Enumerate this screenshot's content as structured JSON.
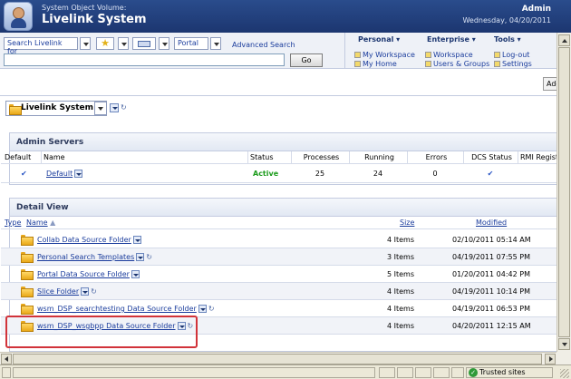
{
  "header": {
    "volume_label": "System Object Volume:",
    "system_title": "Livelink System",
    "user": "Admin",
    "date": "Wednesday, 04/20/2011"
  },
  "search": {
    "scope_label": "Search Livelink for",
    "portal_label": "Portal",
    "advanced_link": "Advanced Search",
    "go_label": "Go",
    "query_value": ""
  },
  "menus": {
    "personal": {
      "label": "Personal ▾",
      "items": [
        "My Workspace",
        "My Home"
      ]
    },
    "enterprise": {
      "label": "Enterprise ▾",
      "items": [
        "Workspace",
        "Users & Groups"
      ]
    },
    "tools": {
      "label": "Tools ▾",
      "items": [
        "Log-out",
        "Settings"
      ]
    }
  },
  "toolbar": {
    "add_label": "Add Item",
    "location_label": "Livelink System"
  },
  "admin_servers": {
    "title": "Admin Servers",
    "columns": [
      "Default",
      "Name",
      "Status",
      "Processes",
      "Running",
      "Errors",
      "DCS Status",
      "RMI Registry"
    ],
    "rows": [
      {
        "name": "Default",
        "status": "Active",
        "processes": "25",
        "running": "24",
        "errors": "0"
      }
    ]
  },
  "detail_view": {
    "title": "Detail View",
    "columns": {
      "type": "Type",
      "name": "Name",
      "size": "Size",
      "modified": "Modified"
    },
    "rows": [
      {
        "name": "Collab Data Source Folder",
        "size": "4 Items",
        "modified": "02/10/2011 05:14 AM"
      },
      {
        "name": "Personal Search Templates",
        "size": "3 Items",
        "modified": "04/19/2011 07:55 PM"
      },
      {
        "name": "Portal Data Source Folder",
        "size": "5 Items",
        "modified": "01/20/2011 04:42 PM"
      },
      {
        "name": "Slice Folder",
        "size": "4 Items",
        "modified": "04/19/2011 10:14 PM"
      },
      {
        "name": "wsm_DSP_searchtesting Data Source Folder",
        "size": "4 Items",
        "modified": "04/19/2011 06:53 PM"
      },
      {
        "name": "wsm_DSP_wsgbpp Data Source Folder",
        "size": "4 Items",
        "modified": "04/20/2011 12:15 AM"
      }
    ]
  },
  "statusbar": {
    "zone": "Trusted sites"
  },
  "colors": {
    "header": "#1c3670",
    "active": "#1c9c1c",
    "highlight": "#d1333a"
  }
}
